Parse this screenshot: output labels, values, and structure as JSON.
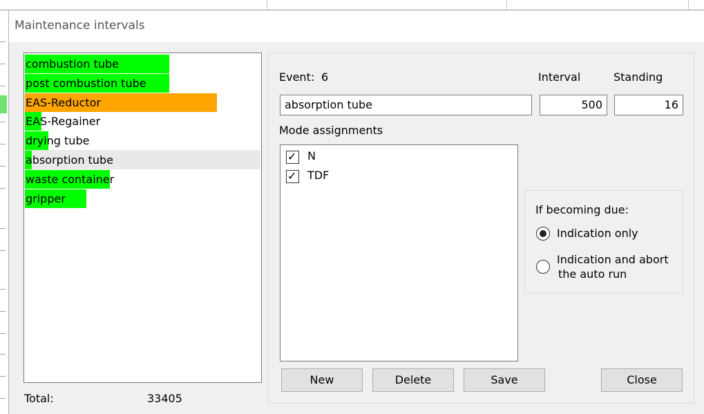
{
  "window": {
    "title": "Maintenance intervals"
  },
  "event_list": {
    "items": [
      {
        "label": "combustion tube",
        "color": "#00ff00",
        "bar_fraction": 0.61,
        "selected": false
      },
      {
        "label": "post combustion tube",
        "color": "#00ff00",
        "bar_fraction": 0.61,
        "selected": false
      },
      {
        "label": "EAS-Reductor",
        "color": "#ffa500",
        "bar_fraction": 0.81,
        "selected": false
      },
      {
        "label": "EAS-Regainer",
        "color": "#00ff00",
        "bar_fraction": 0.07,
        "selected": false
      },
      {
        "label": "drying tube",
        "color": "#00ff00",
        "bar_fraction": 0.1,
        "selected": false
      },
      {
        "label": "absorption tube",
        "color": "#00ff00",
        "bar_fraction": 0.03,
        "selected": true
      },
      {
        "label": "waste container",
        "color": "#00ff00",
        "bar_fraction": 0.36,
        "selected": false
      },
      {
        "label": "gripper",
        "color": "#00ff00",
        "bar_fraction": 0.26,
        "selected": false
      }
    ]
  },
  "totals": {
    "label": "Total:",
    "value": "33405"
  },
  "detail": {
    "event_label": "Event:",
    "event_number": "6",
    "interval_label": "Interval",
    "standing_label": "Standing",
    "name_value": "absorption tube",
    "interval_value": "500",
    "standing_value": "16",
    "mode_assignments_label": "Mode assignments",
    "modes": [
      {
        "label": "N",
        "checked": true
      },
      {
        "label": "TDF",
        "checked": true
      }
    ]
  },
  "due_options": {
    "heading": "If becoming due:",
    "option1": "Indication only",
    "option2_line1": "Indication and abort",
    "option2_line2": "the auto run",
    "selected": "option1"
  },
  "buttons": {
    "new": "New",
    "delete": "Delete",
    "save": "Save",
    "close": "Close"
  }
}
